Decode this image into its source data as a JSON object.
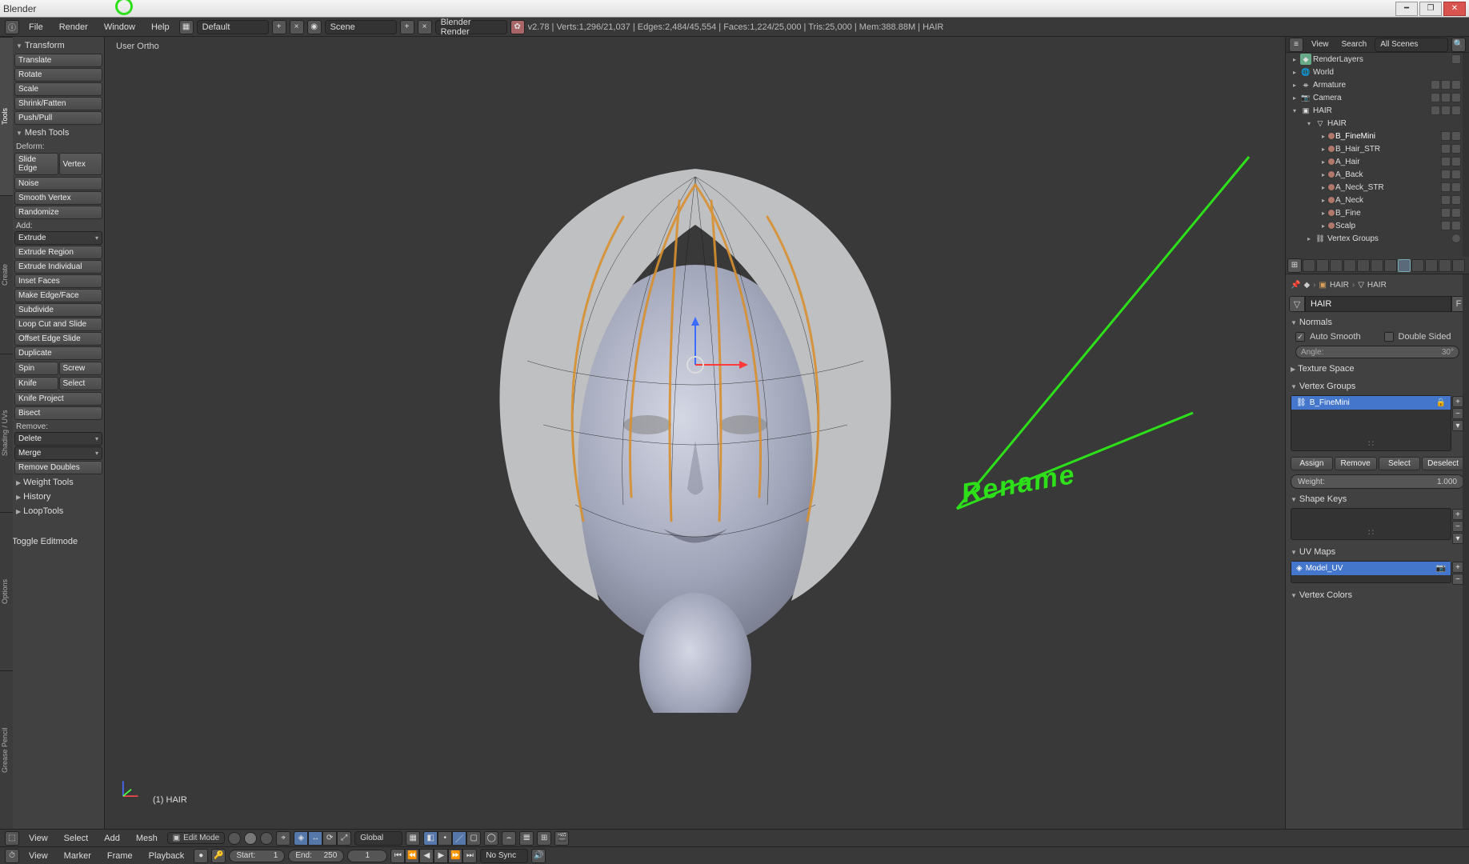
{
  "app_title": "Blender",
  "top_menu": [
    "File",
    "Render",
    "Window",
    "Help"
  ],
  "layout_name": "Default",
  "scene_name": "Scene",
  "engine": "Blender Render",
  "stats": "v2.78 | Verts:1,296/21,037 | Edges:2,484/45,554 | Faces:1,224/25,000 | Tris:25,000 | Mem:388.88M | HAIR",
  "vtabs": [
    "Tools",
    "Create",
    "Shading / UVs",
    "Options",
    "Grease Pencil"
  ],
  "tool_panels": {
    "transform": {
      "title": "Transform",
      "buttons": [
        "Translate",
        "Rotate",
        "Scale",
        "Shrink/Fatten",
        "Push/Pull"
      ]
    },
    "mesh": {
      "title": "Mesh Tools",
      "deform_label": "Deform:",
      "deform_row": [
        "Slide Edge",
        "Vertex"
      ],
      "deform_more": [
        "Noise",
        "Smooth Vertex",
        "Randomize"
      ],
      "add_label": "Add:",
      "extrude_drop": "Extrude",
      "add_more": [
        "Extrude Region",
        "Extrude Individual",
        "Inset Faces",
        "Make Edge/Face",
        "Subdivide",
        "Loop Cut and Slide",
        "Offset Edge Slide",
        "Duplicate"
      ],
      "pair1": [
        "Spin",
        "Screw"
      ],
      "pair2": [
        "Knife",
        "Select"
      ],
      "pair_after": [
        "Knife Project",
        "Bisect"
      ],
      "remove_label": "Remove:",
      "delete_drop": "Delete",
      "merge_drop": "Merge",
      "remove_after": [
        "Remove Doubles"
      ]
    },
    "weight": "Weight Tools",
    "history": "History",
    "looptools": "LoopTools",
    "toggle": "Toggle Editmode"
  },
  "viewport": {
    "label": "User Ortho",
    "object_label": "(1) HAIR"
  },
  "outliner": {
    "header": {
      "view": "View",
      "search": "Search",
      "filter": "All Scenes"
    },
    "items": [
      {
        "indent": 0,
        "icon": "scene",
        "name": "RenderLayers",
        "right": [
          "pin"
        ]
      },
      {
        "indent": 0,
        "icon": "world",
        "name": "World"
      },
      {
        "indent": 0,
        "icon": "arm",
        "name": "Armature",
        "right": [
          "eye",
          "sel",
          "rend"
        ],
        "decor": true
      },
      {
        "indent": 0,
        "icon": "cam",
        "name": "Camera",
        "right": [
          "eye",
          "sel",
          "rend"
        ],
        "decor": true
      },
      {
        "indent": 0,
        "icon": "mesh",
        "name": "HAIR",
        "right": [
          "eye",
          "sel",
          "rend"
        ],
        "expanded": true
      },
      {
        "indent": 1,
        "icon": "meshdata",
        "name": "HAIR",
        "expanded": true
      },
      {
        "indent": 2,
        "icon": "mat",
        "name": "B_FineMini",
        "mat": true,
        "sel": true
      },
      {
        "indent": 2,
        "icon": "mat",
        "name": "B_Hair_STR",
        "mat": true
      },
      {
        "indent": 2,
        "icon": "mat",
        "name": "A_Hair",
        "mat": true
      },
      {
        "indent": 2,
        "icon": "mat",
        "name": "A_Back",
        "mat": true
      },
      {
        "indent": 2,
        "icon": "mat",
        "name": "A_Neck_STR",
        "mat": true
      },
      {
        "indent": 2,
        "icon": "mat",
        "name": "A_Neck",
        "mat": true
      },
      {
        "indent": 2,
        "icon": "mat",
        "name": "B_Fine",
        "mat": true
      },
      {
        "indent": 2,
        "icon": "mat",
        "name": "Scalp",
        "mat": true
      },
      {
        "indent": 1,
        "icon": "vg",
        "name": "Vertex Groups",
        "extra": true
      }
    ]
  },
  "props": {
    "crumb": [
      "HAIR",
      "HAIR"
    ],
    "name_field": "HAIR",
    "normals": {
      "title": "Normals",
      "auto_smooth": "Auto Smooth",
      "double_sided": "Double Sided",
      "angle_label": "Angle:",
      "angle_val": "30°"
    },
    "texture_space": "Texture Space",
    "vertex_groups": {
      "title": "Vertex Groups",
      "item": "B_FineMini",
      "buttons": [
        "Assign",
        "Remove",
        "Select",
        "Deselect"
      ],
      "weight_label": "Weight:",
      "weight_val": "1.000"
    },
    "shape_keys": "Shape Keys",
    "uv_maps": {
      "title": "UV Maps",
      "item": "Model_UV"
    },
    "vertex_colors": "Vertex Colors"
  },
  "vheader": {
    "menus": [
      "View",
      "Select",
      "Add",
      "Mesh"
    ],
    "mode": "Edit Mode",
    "orient": "Global"
  },
  "timeline": {
    "menus": [
      "View",
      "Marker",
      "Frame",
      "Playback"
    ],
    "start_label": "Start:",
    "start_val": "1",
    "end_label": "End:",
    "end_val": "250",
    "cur_val": "1",
    "sync": "No Sync"
  },
  "annotation": "Rename"
}
